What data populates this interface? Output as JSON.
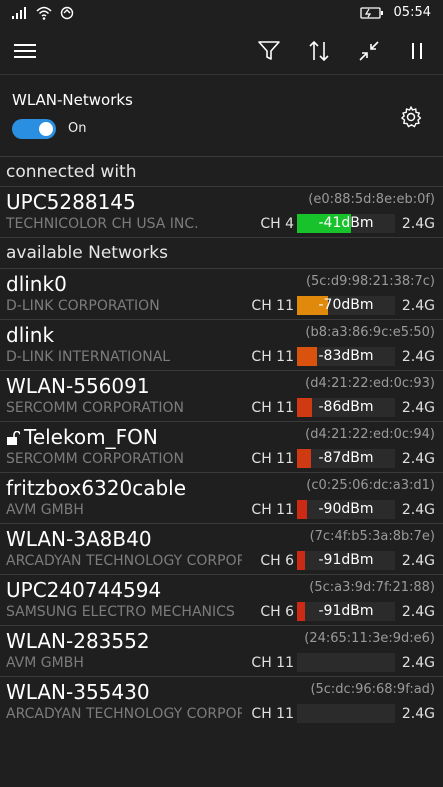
{
  "status": {
    "time": "05:54"
  },
  "wifi": {
    "label": "WLAN-Networks",
    "toggle_state": "On"
  },
  "sections": {
    "connected": "connected with",
    "available": "available Networks"
  },
  "connected": {
    "ssid": "UPC5288145",
    "mac": "(e0:88:5d:8e:eb:0f)",
    "vendor": "TECHNICOLOR CH USA INC.",
    "channel": "CH 4",
    "dbm": "-41dBm",
    "band": "2.4G",
    "signal_fraction": 0.55,
    "color": "#18c22a"
  },
  "networks": [
    {
      "ssid": "dlink0",
      "mac": "(5c:d9:98:21:38:7c)",
      "vendor": "D-LINK CORPORATION",
      "channel": "CH 11",
      "dbm": "-70dBm",
      "band": "2.4G",
      "signal_fraction": 0.32,
      "color": "#e0890a",
      "locked": false
    },
    {
      "ssid": "dlink",
      "mac": "(b8:a3:86:9c:e5:50)",
      "vendor": "D-LINK INTERNATIONAL",
      "channel": "CH 11",
      "dbm": "-83dBm",
      "band": "2.4G",
      "signal_fraction": 0.2,
      "color": "#d9520e",
      "locked": false
    },
    {
      "ssid": "WLAN-556091",
      "mac": "(d4:21:22:ed:0c:93)",
      "vendor": "SERCOMM CORPORATION",
      "channel": "CH 11",
      "dbm": "-86dBm",
      "band": "2.4G",
      "signal_fraction": 0.15,
      "color": "#d03a12",
      "locked": false
    },
    {
      "ssid": "Telekom_FON",
      "mac": "(d4:21:22:ed:0c:94)",
      "vendor": "SERCOMM CORPORATION",
      "channel": "CH 11",
      "dbm": "-87dBm",
      "band": "2.4G",
      "signal_fraction": 0.14,
      "color": "#d03a12",
      "locked": true
    },
    {
      "ssid": "fritzbox6320cable",
      "mac": "(c0:25:06:dc:a3:d1)",
      "vendor": "AVM GMBH",
      "channel": "CH 11",
      "dbm": "-90dBm",
      "band": "2.4G",
      "signal_fraction": 0.1,
      "color": "#cc2a14",
      "locked": false
    },
    {
      "ssid": "WLAN-3A8B40",
      "mac": "(7c:4f:b5:3a:8b:7e)",
      "vendor": "ARCADYAN TECHNOLOGY CORPORATION",
      "channel": "CH 6",
      "dbm": "-91dBm",
      "band": "2.4G",
      "signal_fraction": 0.08,
      "color": "#cc2a14",
      "locked": false
    },
    {
      "ssid": "UPC240744594",
      "mac": "(5c:a3:9d:7f:21:88)",
      "vendor": "SAMSUNG ELECTRO MECHANICS",
      "channel": "CH 6",
      "dbm": "-91dBm",
      "band": "2.4G",
      "signal_fraction": 0.08,
      "color": "#cc2a14",
      "locked": false
    },
    {
      "ssid": "WLAN-283552",
      "mac": "(24:65:11:3e:9d:e6)",
      "vendor": "AVM GMBH",
      "channel": "CH 11",
      "dbm": "",
      "band": "2.4G",
      "signal_fraction": 0,
      "color": "#cc2a14",
      "locked": false
    },
    {
      "ssid": "WLAN-355430",
      "mac": "(5c:dc:96:68:9f:ad)",
      "vendor": "ARCADYAN TECHNOLOGY CORPORATION",
      "channel": "CH 11",
      "dbm": "",
      "band": "2.4G",
      "signal_fraction": 0,
      "color": "#cc2a14",
      "locked": false
    }
  ]
}
